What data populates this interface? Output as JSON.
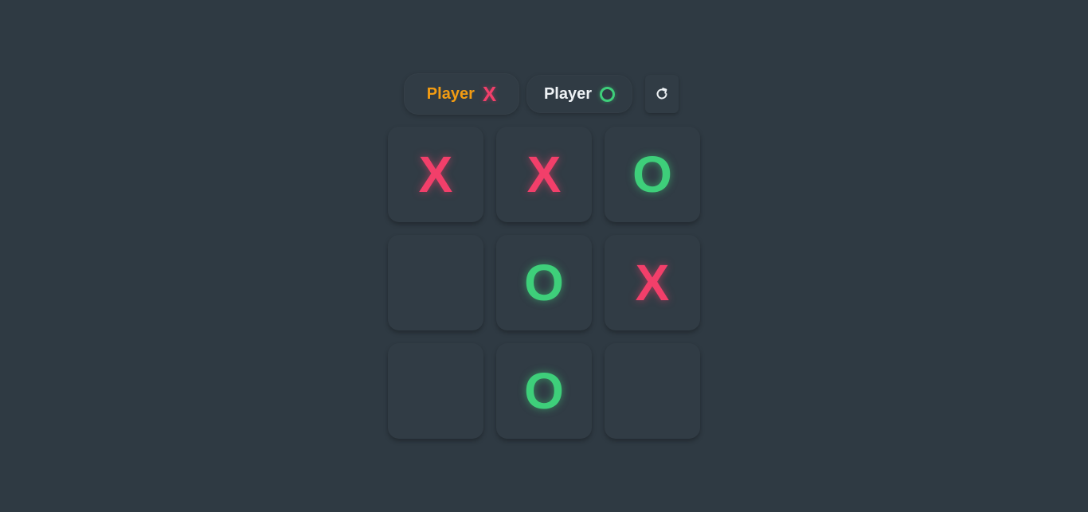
{
  "players": {
    "x": {
      "label": "Player",
      "mark": "X",
      "active": true
    },
    "o": {
      "label": "Player",
      "mark": "O",
      "active": false
    }
  },
  "restart": {
    "icon": "restart-icon"
  },
  "board": {
    "cells": [
      "X",
      "X",
      "O",
      "",
      "O",
      "X",
      "",
      "O",
      ""
    ]
  },
  "colors": {
    "background": "#2f3a43",
    "tile": "#313c45",
    "x": "#f23f6a",
    "o": "#3ecf7a",
    "active_label": "#f39c12",
    "inactive_label": "#eef2f5"
  }
}
